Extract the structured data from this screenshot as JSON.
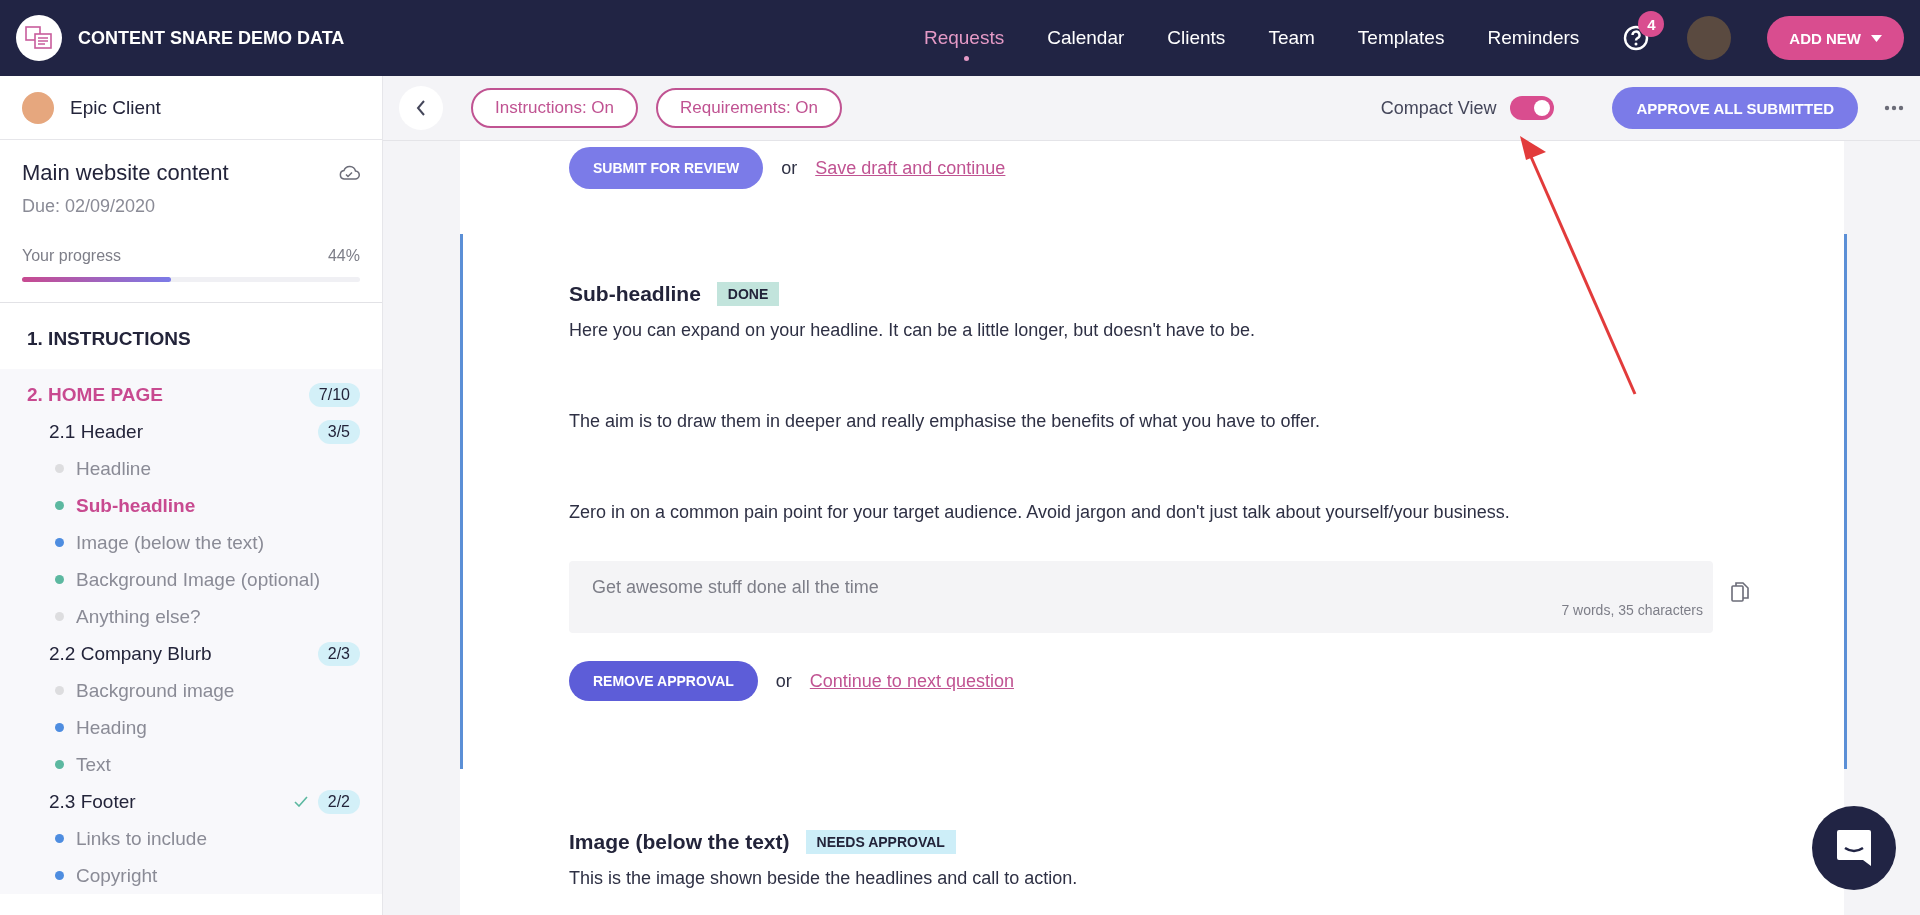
{
  "navbar": {
    "brand": "CONTENT SNARE DEMO DATA",
    "nav_items": [
      {
        "label": "Requests",
        "selected": true
      },
      {
        "label": "Calendar",
        "selected": false
      },
      {
        "label": "Clients",
        "selected": false
      },
      {
        "label": "Team",
        "selected": false
      },
      {
        "label": "Templates",
        "selected": false
      },
      {
        "label": "Reminders",
        "selected": false
      }
    ],
    "help_badge": "4",
    "add_new": "ADD NEW"
  },
  "sidebar": {
    "client": "Epic Client",
    "request_title": "Main website content",
    "due": "Due: 02/09/2020",
    "progress": {
      "label": "Your progress",
      "reading": "44%",
      "level": 0.44
    },
    "sections": [
      {
        "label": "1. INSTRUCTIONS",
        "selected": false
      },
      {
        "label": "2. HOME PAGE",
        "count": "7/10",
        "selected": true,
        "children": [
          {
            "label": "2.1 Header",
            "count": "3/5",
            "complete": false,
            "children": [
              {
                "label": "Headline",
                "color": "#dddddf",
                "selected": false
              },
              {
                "label": "Sub-headline",
                "color": "#5cb8a0",
                "selected": true
              },
              {
                "label": "Image (below the text)",
                "color": "#4e8de0",
                "selected": false
              },
              {
                "label": "Background Image (optional)",
                "color": "#5cb8a0",
                "selected": false
              },
              {
                "label": "Anything else?",
                "color": "#dddddf",
                "selected": false
              }
            ]
          },
          {
            "label": "2.2 Company Blurb",
            "count": "2/3",
            "complete": false,
            "children": [
              {
                "label": "Background image",
                "color": "#dddddf",
                "selected": false
              },
              {
                "label": "Heading",
                "color": "#4e8de0",
                "selected": false
              },
              {
                "label": "Text",
                "color": "#5cb8a0",
                "selected": false
              }
            ]
          },
          {
            "label": "2.3 Footer",
            "count": "2/2",
            "complete": true,
            "children": [
              {
                "label": "Links to include",
                "color": "#4e8de0",
                "selected": false
              },
              {
                "label": "Copyright",
                "color": "#4e8de0",
                "selected": false
              }
            ]
          }
        ]
      }
    ]
  },
  "toolbar": {
    "instructions": "Instructions: On",
    "requirements": "Requirements: On",
    "compact_view": {
      "label": "Compact View",
      "on": true
    },
    "approve_all": "APPROVE ALL SUBMITTED"
  },
  "content": {
    "top_actions": {
      "button": "SUBMIT FOR REVIEW",
      "or": "or",
      "link": "Save draft and continue"
    },
    "questions": [
      {
        "title": "Sub-headline",
        "status": {
          "label": "DONE",
          "kind": "done"
        },
        "active": true,
        "paragraphs": [
          "Here you can expand on your headline. It can be a little longer, but doesn't have to be.",
          "The aim is to draw them in deeper and really emphasise the benefits of what you have to offer.",
          "Zero in on a common pain point for your target audience. Avoid jargon and don't just talk about yourself/your business."
        ],
        "answer": {
          "value": "Get awesome stuff done all the time",
          "count": "7 words, 35 characters"
        },
        "actions": {
          "button": "REMOVE APPROVAL",
          "or": "or",
          "link": "Continue to next question"
        }
      },
      {
        "title": "Image (below the text)",
        "status": {
          "label": "NEEDS APPROVAL",
          "kind": "needs_approval"
        },
        "active": false,
        "paragraphs": [
          "This is the image shown beside the headlines and call to action."
        ]
      }
    ]
  }
}
